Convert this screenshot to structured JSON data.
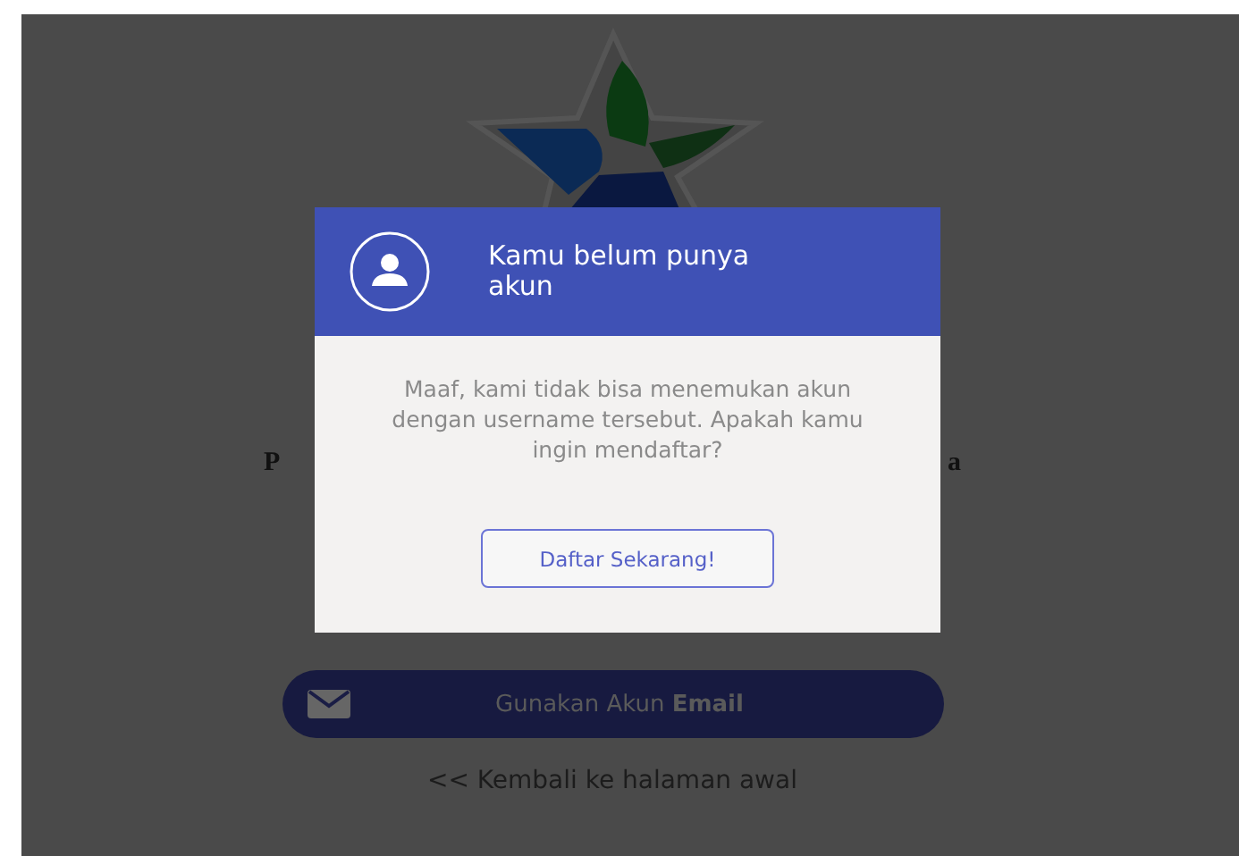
{
  "page": {
    "heading_left": "P",
    "heading_right": "a",
    "email_button": "Gunakan Akun **Email**",
    "back_link": "<< Kembali ke halaman awal"
  },
  "modal": {
    "title": "Kamu belum punya akun",
    "message": "Maaf, kami tidak bisa menemukan akun dengan username tersebut. Apakah kamu ingin mendaftar?",
    "button": "Daftar Sekarang!"
  }
}
